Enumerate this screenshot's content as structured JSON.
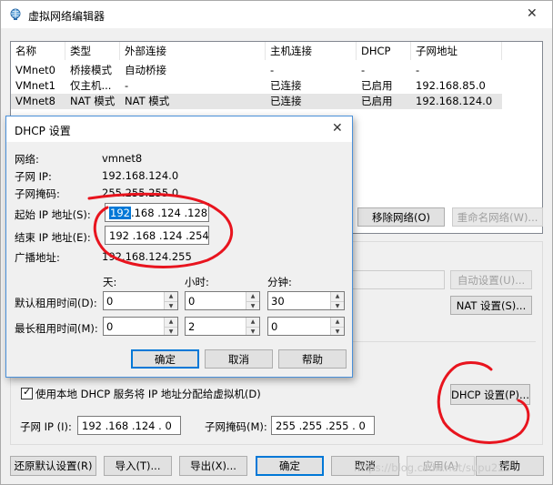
{
  "window": {
    "title": "虚拟网络编辑器",
    "close": "✕"
  },
  "table": {
    "columns": [
      "名称",
      "类型",
      "外部连接",
      "主机连接",
      "DHCP",
      "子网地址"
    ],
    "rows": [
      [
        "VMnet0",
        "桥接模式",
        "自动桥接",
        "-",
        "-",
        "-"
      ],
      [
        "VMnet1",
        "仅主机...",
        "-",
        "已连接",
        "已启用",
        "192.168.85.0"
      ],
      [
        "VMnet8",
        "NAT 模式",
        "NAT 模式",
        "已连接",
        "已启用",
        "192.168.124.0"
      ]
    ]
  },
  "network_buttons": {
    "remove": "移除网络(O)",
    "rename": "重命名网络(W)..."
  },
  "settings_buttons": {
    "auto": "自动设置(U)...",
    "nat": "NAT 设置(S)...",
    "dhcp": "DHCP 设置(P)..."
  },
  "dhcp_option": {
    "label": "使用本地 DHCP 服务将 IP 地址分配给虚拟机(D)",
    "checked": true
  },
  "subnet": {
    "ip_label": "子网 IP (I):",
    "ip_value": "192 .168 .124 .  0",
    "mask_label": "子网掩码(M):",
    "mask_value": "255 .255 .255 .  0"
  },
  "bottom_buttons": {
    "restore": "还原默认设置(R)",
    "import": "导入(T)...",
    "export": "导出(X)...",
    "ok": "确定",
    "cancel": "取消",
    "apply": "应用(A)",
    "help": "帮助"
  },
  "watermark": "https://blog.csdn.net/supu223",
  "dialog": {
    "title": "DHCP 设置",
    "close": "✕",
    "network_label": "网络:",
    "network_value": "vmnet8",
    "subnet_ip_label": "子网 IP:",
    "subnet_ip_value": "192.168.124.0",
    "mask_label": "子网掩码:",
    "mask_value": "255.255.255.0",
    "start_label": "起始 IP 地址(S):",
    "start_first": "192",
    "start_rest": " .168 .124 .128",
    "end_label": "结束 IP 地址(E):",
    "end_value": "192 .168 .124 .254",
    "broadcast_label": "广播地址:",
    "broadcast_value": "192.168.124.255",
    "col_days": "天:",
    "col_hours": "小时:",
    "col_minutes": "分钟:",
    "default_lease_label": "默认租用时间(D):",
    "default_lease": {
      "days": "0",
      "hours": "0",
      "minutes": "30"
    },
    "max_lease_label": "最长租用时间(M):",
    "max_lease": {
      "days": "0",
      "hours": "2",
      "minutes": "0"
    },
    "ok": "确定",
    "cancel": "取消",
    "help": "帮助"
  },
  "colors": {
    "accent": "#0078d7",
    "selection": "#0078d7",
    "annotation": "#e8141e",
    "disabled_text": "#a0a0a0"
  }
}
